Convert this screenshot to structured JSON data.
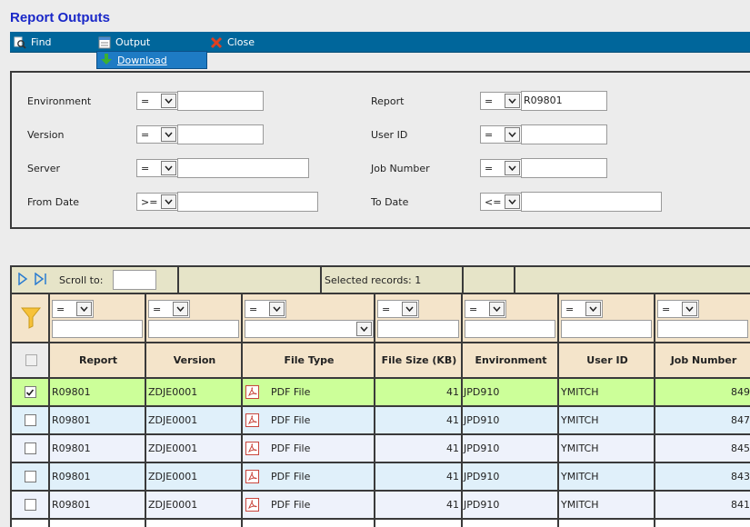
{
  "page_title": "Report Outputs",
  "toolbar": {
    "find_label": "Find",
    "output_label": "Output",
    "close_label": "Close",
    "download_label": "Download"
  },
  "form": {
    "environment": {
      "label": "Environment",
      "op": "=",
      "value": ""
    },
    "version": {
      "label": "Version",
      "op": "=",
      "value": ""
    },
    "server": {
      "label": "Server",
      "op": "=",
      "value": ""
    },
    "from_date": {
      "label": "From Date",
      "op": ">=",
      "value": ""
    },
    "report": {
      "label": "Report",
      "op": "=",
      "value": "R09801"
    },
    "user_id": {
      "label": "User ID",
      "op": "=",
      "value": ""
    },
    "job_number": {
      "label": "Job Number",
      "op": "=",
      "value": ""
    },
    "to_date": {
      "label": "To Date",
      "op": "<=",
      "value": ""
    }
  },
  "grid": {
    "scroll_to_label": "Scroll to:",
    "selected_records": "Selected records: 1",
    "filter_ops": [
      "=",
      "=",
      "=",
      "=",
      "=",
      "=",
      "="
    ],
    "columns": [
      "Report",
      "Version",
      "File Type",
      "File Size (KB)",
      "Environment",
      "User ID",
      "Job Number"
    ],
    "rows": [
      {
        "selected": true,
        "report": "R09801",
        "version": "ZDJE0001",
        "file_type": "PDF File",
        "file_size": "41",
        "environment": "JPD910",
        "user_id": "YMITCH",
        "job_number": "849"
      },
      {
        "selected": false,
        "report": "R09801",
        "version": "ZDJE0001",
        "file_type": "PDF File",
        "file_size": "41",
        "environment": "JPD910",
        "user_id": "YMITCH",
        "job_number": "847"
      },
      {
        "selected": false,
        "report": "R09801",
        "version": "ZDJE0001",
        "file_type": "PDF File",
        "file_size": "41",
        "environment": "JPD910",
        "user_id": "YMITCH",
        "job_number": "845"
      },
      {
        "selected": false,
        "report": "R09801",
        "version": "ZDJE0001",
        "file_type": "PDF File",
        "file_size": "41",
        "environment": "JPD910",
        "user_id": "YMITCH",
        "job_number": "843"
      },
      {
        "selected": false,
        "report": "R09801",
        "version": "ZDJE0001",
        "file_type": "PDF File",
        "file_size": "41",
        "environment": "JPD910",
        "user_id": "YMITCH",
        "job_number": "841"
      }
    ]
  },
  "colors": {
    "title": "#1a28c8",
    "toolbar": "#00669b",
    "selected_row": "#ccff99",
    "row_alt": "#e0f0fa",
    "header": "#f4e4ca"
  }
}
